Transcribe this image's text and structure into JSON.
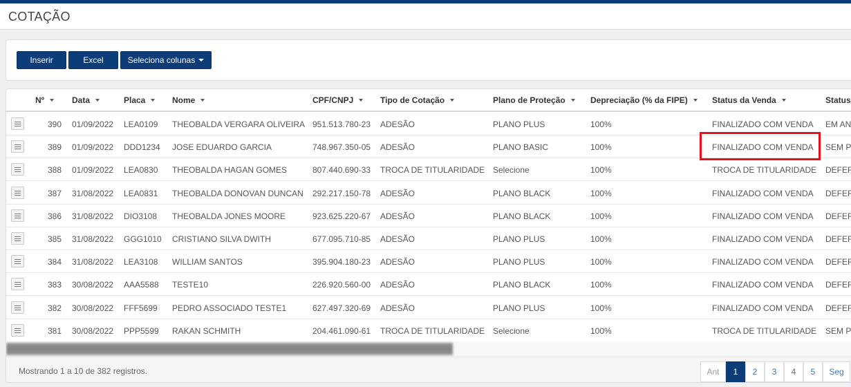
{
  "header": {
    "title": "COTAÇÃO"
  },
  "toolbar": {
    "insert_label": "Inserir",
    "excel_label": "Excel",
    "columns_label": "Seleciona colunas"
  },
  "table": {
    "columns": [
      "Nº",
      "Data",
      "Placa",
      "Nome",
      "CPF/CNPJ",
      "Tipo de Cotação",
      "Plano de Proteção",
      "Depreciação (% da FIPE)",
      "Status da Venda",
      "Status"
    ],
    "rows": [
      [
        "390",
        "01/09/2022",
        "LEA0109",
        "THEOBALDA VERGARA OLIVEIRA",
        "951.513.780-23",
        "ADESÃO",
        "PLANO PLUS",
        "100%",
        "FINALIZADO COM VENDA",
        "EM ANA"
      ],
      [
        "389",
        "01/09/2022",
        "DDD1234",
        "JOSE EDUARDO GARCIA",
        "748.967.350-05",
        "ADESÃO",
        "PLANO BASIC",
        "100%",
        "FINALIZADO COM VENDA",
        "SEM PE"
      ],
      [
        "388",
        "01/09/2022",
        "LEA0830",
        "THEOBALDA HAGAN GOMES",
        "807.440.690-33",
        "TROCA DE TITULARIDADE",
        "Selecione",
        "100%",
        "TROCA DE TITULARIDADE",
        "DEFER"
      ],
      [
        "387",
        "31/08/2022",
        "LEA0831",
        "THEOBALDA DONOVAN DUNCAN",
        "292.217.150-78",
        "ADESÃO",
        "PLANO BLACK",
        "100%",
        "FINALIZADO COM VENDA",
        "DEFER"
      ],
      [
        "386",
        "31/08/2022",
        "DIO3108",
        "THEOBALDA JONES MOORE",
        "923.625.220-67",
        "ADESÃO",
        "PLANO BLACK",
        "100%",
        "FINALIZADO COM VENDA",
        "DEFER"
      ],
      [
        "385",
        "31/08/2022",
        "GGG1010",
        "CRISTIANO SILVA DWITH",
        "677.095.710-85",
        "ADESÃO",
        "PLANO PLUS",
        "100%",
        "FINALIZADO COM VENDA",
        "DEFER"
      ],
      [
        "384",
        "31/08/2022",
        "LEA3108",
        "WILLIAM SANTOS",
        "395.904.180-23",
        "ADESÃO",
        "PLANO PLUS",
        "100%",
        "FINALIZADO COM VENDA",
        "DEFER"
      ],
      [
        "383",
        "30/08/2022",
        "AAA5588",
        "TESTE10",
        "226.920.560-00",
        "ADESÃO",
        "PLANO BLACK",
        "100%",
        "FINALIZADO COM VENDA",
        "DEFER"
      ],
      [
        "382",
        "30/08/2022",
        "FFF5699",
        "PEDRO ASSOCIADO TESTE1",
        "627.497.320-69",
        "ADESÃO",
        "PLANO PLUS",
        "100%",
        "FINALIZADO COM VENDA",
        "DEFER"
      ],
      [
        "381",
        "30/08/2022",
        "PPP5599",
        "RAKAN SCHMITH",
        "204.461.090-61",
        "TROCA DE TITULARIDADE",
        "Selecione",
        "100%",
        "TROCA DE TITULARIDADE",
        "SEM PE"
      ]
    ]
  },
  "footer": {
    "info": "Mostrando 1 a 10 de 382 registros."
  },
  "pagination": {
    "prev": "Ant",
    "pages": [
      "1",
      "2",
      "3",
      "4",
      "5"
    ],
    "next": "Seg",
    "active": "1"
  },
  "colors": {
    "primary": "#0d3d78",
    "highlight": "#e3121f"
  }
}
